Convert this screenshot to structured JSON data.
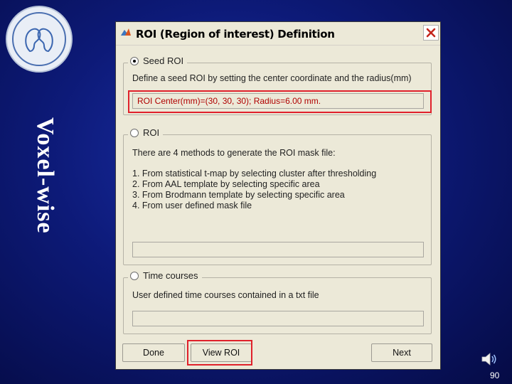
{
  "side_title": "Voxel-wise",
  "window": {
    "title": "ROI (Region of interest) Definition"
  },
  "seed_roi": {
    "label": "Seed ROI",
    "selected": true,
    "description": "Define a seed ROI by setting the center coordinate and the radius(mm)",
    "value": "ROI Center(mm)=(30, 30, 30); Radius=6.00 mm."
  },
  "roi": {
    "label": "ROI",
    "selected": false,
    "intro": "There are 4 methods to generate the ROI mask file:",
    "methods": [
      "1. From statistical t-map by selecting cluster after thresholding",
      "2. From AAL template by selecting specific area",
      "3. From Brodmann template by selecting specific area",
      "4. From user defined mask file"
    ],
    "value": ""
  },
  "time_courses": {
    "label": "Time courses",
    "selected": false,
    "description": "User defined time courses contained in a txt file",
    "value": ""
  },
  "buttons": {
    "done": "Done",
    "view_roi": "View ROI",
    "next": "Next"
  },
  "page_number": "90",
  "colors": {
    "background": "#0d1a78",
    "highlight": "#e0212b",
    "field_text": "#b00000"
  },
  "icons": [
    "logo",
    "matlab-icon",
    "close-icon",
    "radio-icon",
    "speaker-icon"
  ]
}
